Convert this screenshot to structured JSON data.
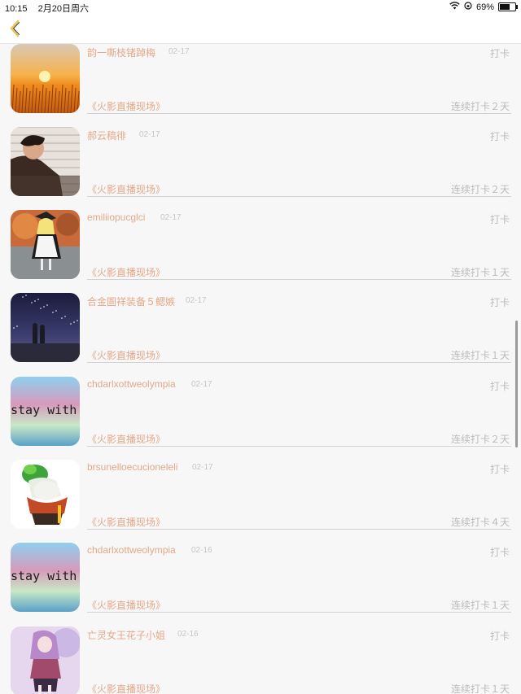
{
  "status_bar": {
    "time": "10:15",
    "date": "2月20日周六",
    "battery": "69%",
    "battery_level": 0.69
  },
  "nav": {
    "back_icon": "chevron-left-icon",
    "accent": "#f0c24a"
  },
  "list": [
    {
      "name": "韵一嘶枝锗踔梅",
      "date": "02-17",
      "action": "打卡",
      "program": "《火影直播现场》",
      "streak": "连续打卡２天",
      "avatar": "wheat-field"
    },
    {
      "name": "郝云稿徘",
      "date": "02-17",
      "action": "打卡",
      "program": "《火影直播现场》",
      "streak": "连续打卡２天",
      "avatar": "man-portrait"
    },
    {
      "name": "emiliiopucglci",
      "date": "02-17",
      "action": "打卡",
      "program": "《火影直播现场》",
      "streak": "连续打卡１天",
      "avatar": "anime-witch"
    },
    {
      "name": "合金圄祥装备５鳃嫉",
      "date": "02-17",
      "action": "打卡",
      "program": "《火影直播现场》",
      "streak": "连续打卡１天",
      "avatar": "night-sky-couple"
    },
    {
      "name": "chdarlxottweolympia",
      "date": "02-17",
      "action": "打卡",
      "program": "《火影直播现场》",
      "streak": "连续打卡２天",
      "avatar": "stay-with-me"
    },
    {
      "name": "brsunelloecucioneleli",
      "date": "02-17",
      "action": "打卡",
      "program": "《火影直播现场》",
      "streak": "连续打卡４天",
      "avatar": "jade-cabbage"
    },
    {
      "name": "chdarlxottweolympia",
      "date": "02-16",
      "action": "打卡",
      "program": "《火影直播现场》",
      "streak": "连续打卡１天",
      "avatar": "stay-with-me"
    },
    {
      "name": "亡灵女王花子小姐",
      "date": "02-16",
      "action": "打卡",
      "program": "《火影直播现场》",
      "streak": "连续打卡１天",
      "avatar": "anime-girl-pink"
    }
  ],
  "colors": {
    "name_text": "#e2a98a",
    "muted_text": "#bbbbbb",
    "background": "#f8f7f8"
  }
}
